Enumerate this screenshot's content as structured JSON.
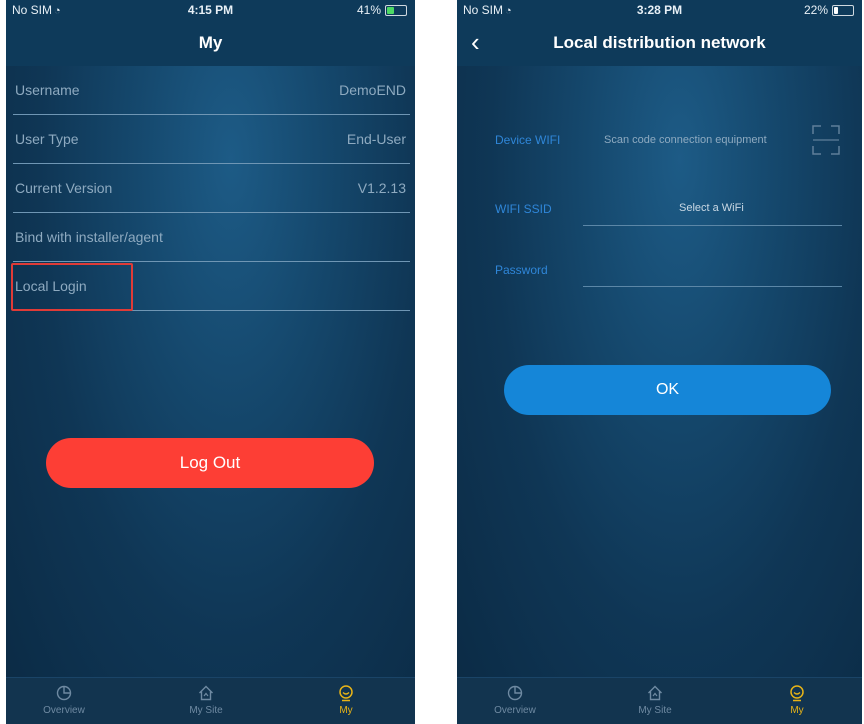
{
  "left_screen": {
    "status_bar": {
      "carrier": "No SIM",
      "time": "4:15 PM",
      "battery": "41%",
      "battery_level": 0.41,
      "battery_color": "#4cd964"
    },
    "title": "My",
    "rows": [
      {
        "label": "Username",
        "value": "DemoEND"
      },
      {
        "label": "User Type",
        "value": "End-User"
      },
      {
        "label": "Current Version",
        "value": "V1.2.13"
      },
      {
        "label": "Bind with installer/agent",
        "value": ""
      },
      {
        "label": "Local Login",
        "value": ""
      }
    ],
    "highlight_color": "#e03b37",
    "logout_label": "Log Out",
    "logout_color": "#fd3e35"
  },
  "right_screen": {
    "status_bar": {
      "carrier": "No SIM",
      "time": "3:28 PM",
      "battery": "22%",
      "battery_level": 0.22,
      "battery_color": "#ffffff"
    },
    "title": "Local distribution network",
    "device_wifi": {
      "label": "Device WIFI",
      "text": "Scan code connection equipment"
    },
    "wifi_ssid": {
      "label": "WIFI SSID",
      "placeholder": "Select a WiFi"
    },
    "password": {
      "label": "Password",
      "value": ""
    },
    "ok_label": "OK",
    "ok_color": "#1586d8"
  },
  "tabs": [
    {
      "label": "Overview",
      "icon": "pie-chart-icon"
    },
    {
      "label": "My Site",
      "icon": "house-icon"
    },
    {
      "label": "My",
      "icon": "user-profile-icon",
      "active": true
    }
  ],
  "accent_color": "#e8b417"
}
